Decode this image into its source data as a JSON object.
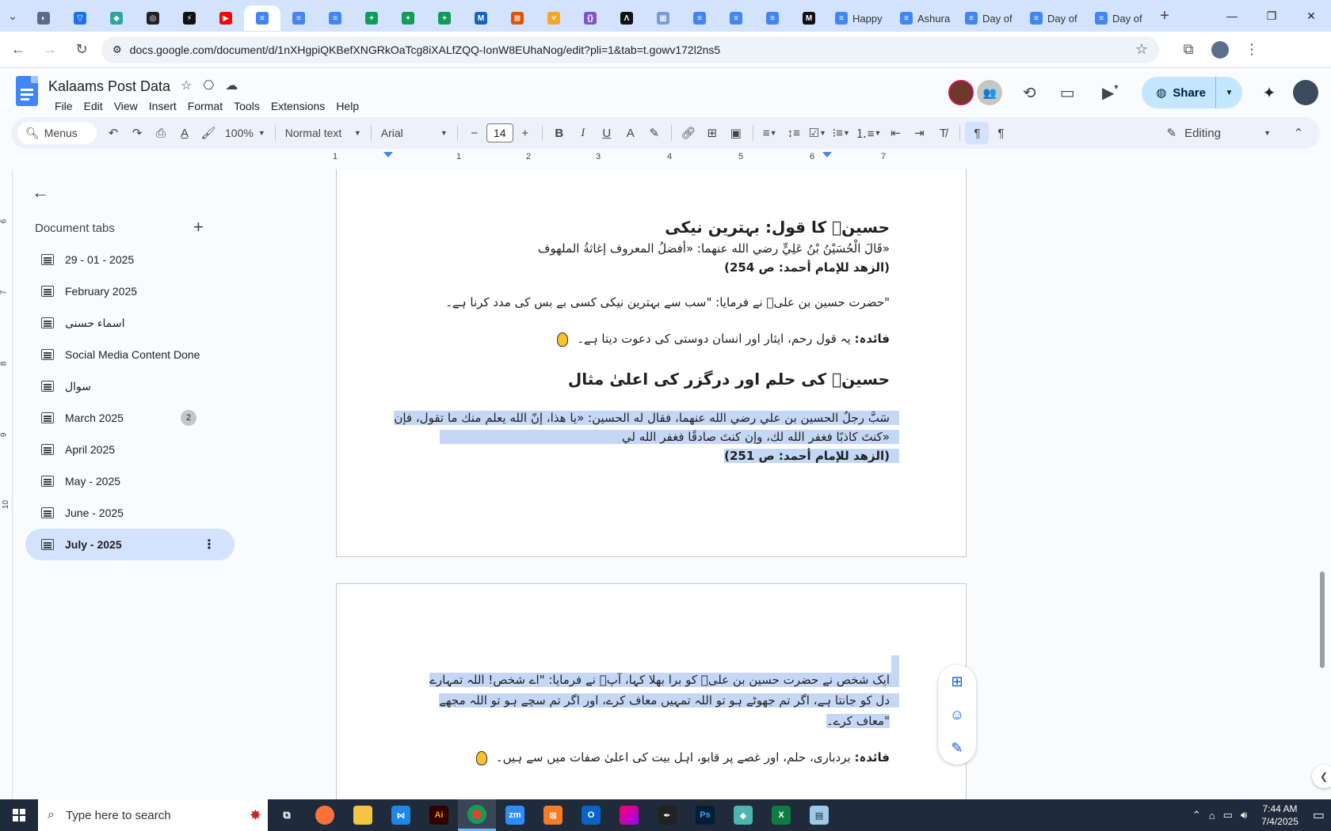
{
  "browser": {
    "tabs": [
      {
        "kind": "icon",
        "color": "#5b6b8c",
        "glyph": "◐"
      },
      {
        "kind": "icon",
        "color": "#1a73e8",
        "glyph": "▽"
      },
      {
        "kind": "icon",
        "color": "#2aa7a1",
        "glyph": "◆"
      },
      {
        "kind": "icon",
        "color": "#222222",
        "glyph": "◎"
      },
      {
        "kind": "icon",
        "color": "#111111",
        "glyph": "⚡"
      },
      {
        "kind": "icon",
        "color": "#ff0000",
        "glyph": "▶"
      },
      {
        "kind": "icon",
        "color": "#4285f4",
        "glyph": "≡",
        "active": true
      },
      {
        "kind": "icon",
        "color": "#4285f4",
        "glyph": "≡"
      },
      {
        "kind": "icon",
        "color": "#4285f4",
        "glyph": "≡"
      },
      {
        "kind": "icon",
        "color": "#0f9d58",
        "glyph": "+"
      },
      {
        "kind": "icon",
        "color": "#0f9d58",
        "glyph": "+"
      },
      {
        "kind": "icon",
        "color": "#0f9d58",
        "glyph": "+"
      },
      {
        "kind": "icon",
        "color": "#1565c0",
        "glyph": "M"
      },
      {
        "kind": "icon",
        "color": "#e65100",
        "glyph": "⊠"
      },
      {
        "kind": "icon",
        "color": "#f5a623",
        "glyph": "˅"
      },
      {
        "kind": "icon",
        "color": "#7e57c2",
        "glyph": "{}"
      },
      {
        "kind": "icon",
        "color": "#111111",
        "glyph": "Λ"
      },
      {
        "kind": "icon",
        "color": "#7b9bd6",
        "glyph": "▦"
      },
      {
        "kind": "icon",
        "color": "#4285f4",
        "glyph": "≡"
      },
      {
        "kind": "icon",
        "color": "#4285f4",
        "glyph": "≡"
      },
      {
        "kind": "icon",
        "color": "#4285f4",
        "glyph": "≡"
      },
      {
        "kind": "icon",
        "color": "#111111",
        "glyph": "M"
      },
      {
        "kind": "titled",
        "color": "#4285f4",
        "glyph": "≡",
        "title": "Happy"
      },
      {
        "kind": "titled",
        "color": "#4285f4",
        "glyph": "≡",
        "title": "Ashura"
      },
      {
        "kind": "titled",
        "color": "#4285f4",
        "glyph": "≡",
        "title": "Day of"
      },
      {
        "kind": "titled",
        "color": "#4285f4",
        "glyph": "≡",
        "title": "Day of"
      },
      {
        "kind": "titled",
        "color": "#4285f4",
        "glyph": "≡",
        "title": "Day of"
      }
    ],
    "new_tab": "+",
    "url": "docs.google.com/document/d/1nXHgpiQKBefXNGRkOaTcg8iXALfZQQ-IonW8EUhaNog/edit?pli=1&tab=t.gowv172l2ns5"
  },
  "doc": {
    "title": "Kalaams Post Data",
    "menu": [
      "File",
      "Edit",
      "View",
      "Insert",
      "Format",
      "Tools",
      "Extensions",
      "Help"
    ],
    "share_label": "Share"
  },
  "toolbar": {
    "menus_label": "Menus",
    "zoom": "100%",
    "style": "Normal text",
    "font": "Arial",
    "font_size": "14",
    "mode": "Editing"
  },
  "ruler": {
    "h_labels": [
      "1",
      "1",
      "2",
      "3",
      "4",
      "5",
      "6",
      "7"
    ],
    "v_labels": [
      "6",
      "7",
      "8",
      "9",
      "10"
    ]
  },
  "sidebar": {
    "heading": "Document tabs",
    "tabs": [
      {
        "label": "29 - 01 - 2025"
      },
      {
        "label": "February 2025"
      },
      {
        "label": "اسماء حسنی"
      },
      {
        "label": "Social Media Content Done"
      },
      {
        "label": "سوال"
      },
      {
        "label": "March 2025",
        "badge": "2"
      },
      {
        "label": "April 2025"
      },
      {
        "label": "May - 2025"
      },
      {
        "label": "June - 2025"
      },
      {
        "label": "July - 2025",
        "selected": true
      }
    ]
  },
  "content": {
    "h1": "حسینؓ کا قول: بہترین نیکی",
    "ar1": "«قَالَ الْحُسَيْنُ بْنُ عَلِيٍّ رضي الله عنهما: «أفضلُ المعروف إغاثةُ الملهوف",
    "ref1": "(الزهد للإمام أحمد: ص 254)",
    "ur1": "\"حضرت حسین بن علیؓ نے فرمایا: \"سب سے بہترین نیکی کسی بے بس کی مدد کرنا ہے۔",
    "note1_label": "فائدہ:",
    "note1": "یہ قول رحم، ایثار اور انسان دوستی کی دعوت دیتا ہے۔",
    "h2": "حسینؓ کی حلم اور درگزر کی اعلیٰ مثال",
    "ar2a": "سَبَّ رجلٌ الحسين بن علي رضي الله عنهما، فقال له الحسين: «يا هذا، إنّ الله يعلم منك ما تقول، فإن",
    "ar2b": "«كنتَ كاذبًا فغفر الله لك، وإن كنتَ صادقًا فغفر الله لي",
    "ref2": "(الزهد للإمام أحمد: ص 251)",
    "ur2a": "ایک شخص نے حضرت حسین بن علیؓ کو برا بھلا کہا، آپؓ نے فرمایا: \"اے شخص! اللہ تمہارے",
    "ur2b": "دل کو جانتا ہے، اگر تم جھوٹے ہو تو اللہ تمہیں معاف کرے، اور اگر تم سچے ہو تو اللہ مجھے",
    "ur2c": "\"معاف کرے۔",
    "note2_label": "فائدہ:",
    "note2": "بردباری، حلم، اور غصے پر قابو، اہل بیت کی اعلیٰ صفات میں سے ہیں۔"
  },
  "taskbar": {
    "search_placeholder": "Type here to search",
    "time": "7:44 AM",
    "date": "7/4/2025"
  }
}
